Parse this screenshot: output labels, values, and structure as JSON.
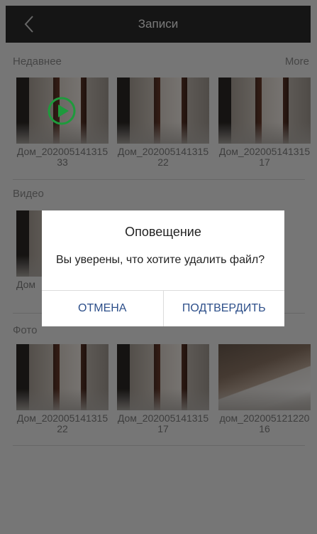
{
  "header": {
    "title": "Записи",
    "back_icon": "chevron-left-icon"
  },
  "recent": {
    "title": "Недавнее",
    "more_label": "More",
    "items": [
      {
        "label": "Дом_20200514131533",
        "type": "video",
        "icon": "play-icon"
      },
      {
        "label": "Дом_20200514131522",
        "type": "video"
      },
      {
        "label": "Дом_20200514131517",
        "type": "video"
      }
    ]
  },
  "videos": {
    "title": "Видео",
    "items": [
      {
        "label": "Дом"
      }
    ]
  },
  "photos": {
    "title": "Фото",
    "items": [
      {
        "label": "Дом_20200514131522"
      },
      {
        "label": "Дом_20200514131517"
      },
      {
        "label": "дом_20200512122016"
      }
    ]
  },
  "dialog": {
    "title": "Оповещение",
    "message": "Вы уверены, что хотите удалить файл?",
    "cancel_label": "ОТМЕНА",
    "confirm_label": "ПОДТВЕРДИТЬ"
  },
  "colors": {
    "header_bg": "#2a2a2a",
    "accent_green": "#1e9a3c",
    "dialog_button": "#2d4f8a"
  }
}
